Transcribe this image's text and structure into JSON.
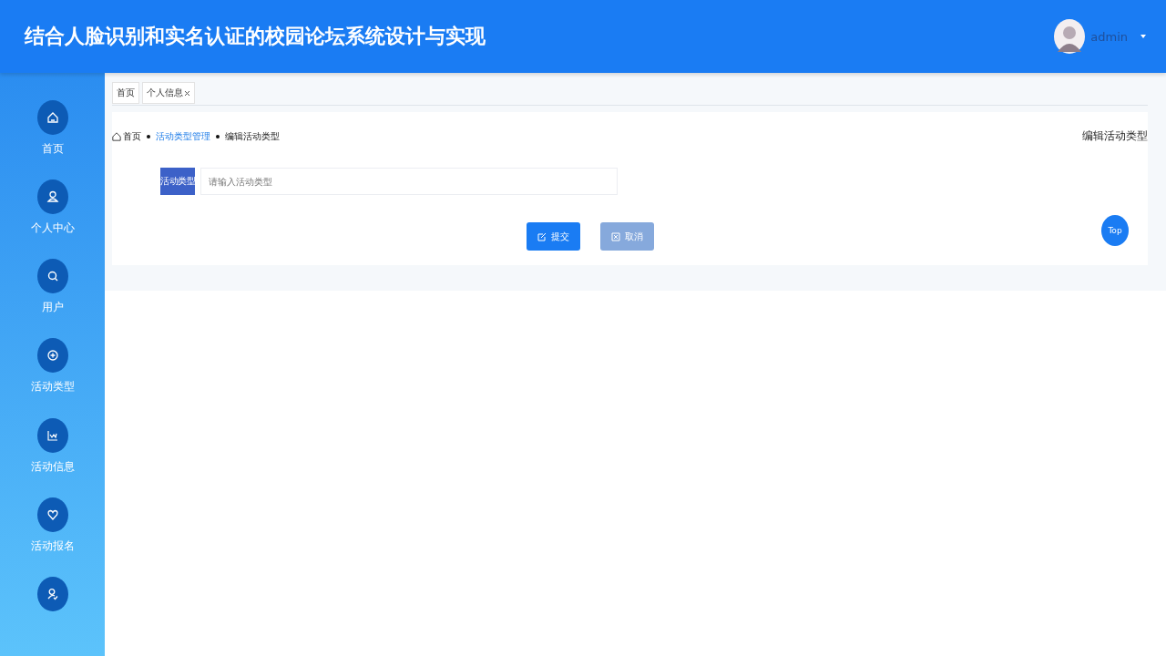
{
  "header": {
    "title": "结合人脸识别和实名认证的校园论坛系统设计与实现",
    "user": "admin"
  },
  "sidebar": {
    "items": [
      {
        "label": "首页",
        "kind": "home"
      },
      {
        "label": "个人中心",
        "kind": "user"
      },
      {
        "label": "用户",
        "kind": "search"
      },
      {
        "label": "活动类型",
        "kind": "plus"
      },
      {
        "label": "活动信息",
        "kind": "chart"
      },
      {
        "label": "活动报名",
        "kind": "heart"
      },
      {
        "kind": "usercheck"
      }
    ]
  },
  "tabs": [
    {
      "label": "首页",
      "closable": false
    },
    {
      "label": "个人信息",
      "closable": true
    }
  ],
  "breadcrumb": [
    {
      "label": "首页",
      "kind": "home"
    },
    {
      "label": "活动类型管理",
      "kind": "link"
    },
    {
      "label": "编辑活动类型",
      "kind": "current"
    }
  ],
  "page_title": "编辑活动类型",
  "form": {
    "fields": [
      {
        "label": "活动类型",
        "placeholder": "请输入活动类型"
      }
    ]
  },
  "buttons": [
    {
      "label": "提交",
      "kind": "primary"
    },
    {
      "label": "取消",
      "kind": "cancel"
    }
  ],
  "top_button": "Top"
}
